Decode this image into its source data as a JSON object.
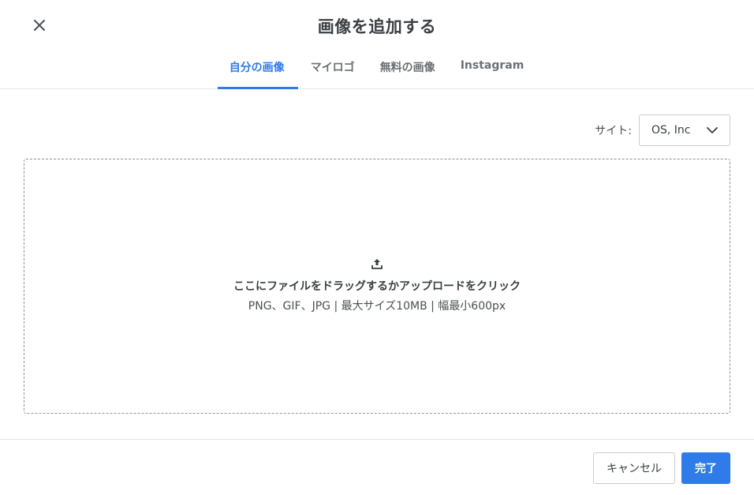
{
  "modal": {
    "title": "画像を追加する",
    "close_icon": "close-icon"
  },
  "tabs": [
    {
      "label": "自分の画像",
      "active": true
    },
    {
      "label": "マイロゴ",
      "active": false
    },
    {
      "label": "無料の画像",
      "active": false
    },
    {
      "label": "Instagram",
      "active": false
    }
  ],
  "site": {
    "label": "サイト:",
    "selected": "OS, Inc",
    "icon": "chevron-down-icon"
  },
  "dropzone": {
    "icon": "upload-icon",
    "instruction": "ここにファイルをドラッグするかアップロードをクリック",
    "requirements": "PNG、GIF、JPG | 最大サイズ10MB | 幅最小600px"
  },
  "footer": {
    "cancel_label": "キャンセル",
    "done_label": "完了"
  },
  "colors": {
    "accent": "#2f7bea",
    "text": "#3a3f44",
    "border": "#c9cdd1"
  }
}
